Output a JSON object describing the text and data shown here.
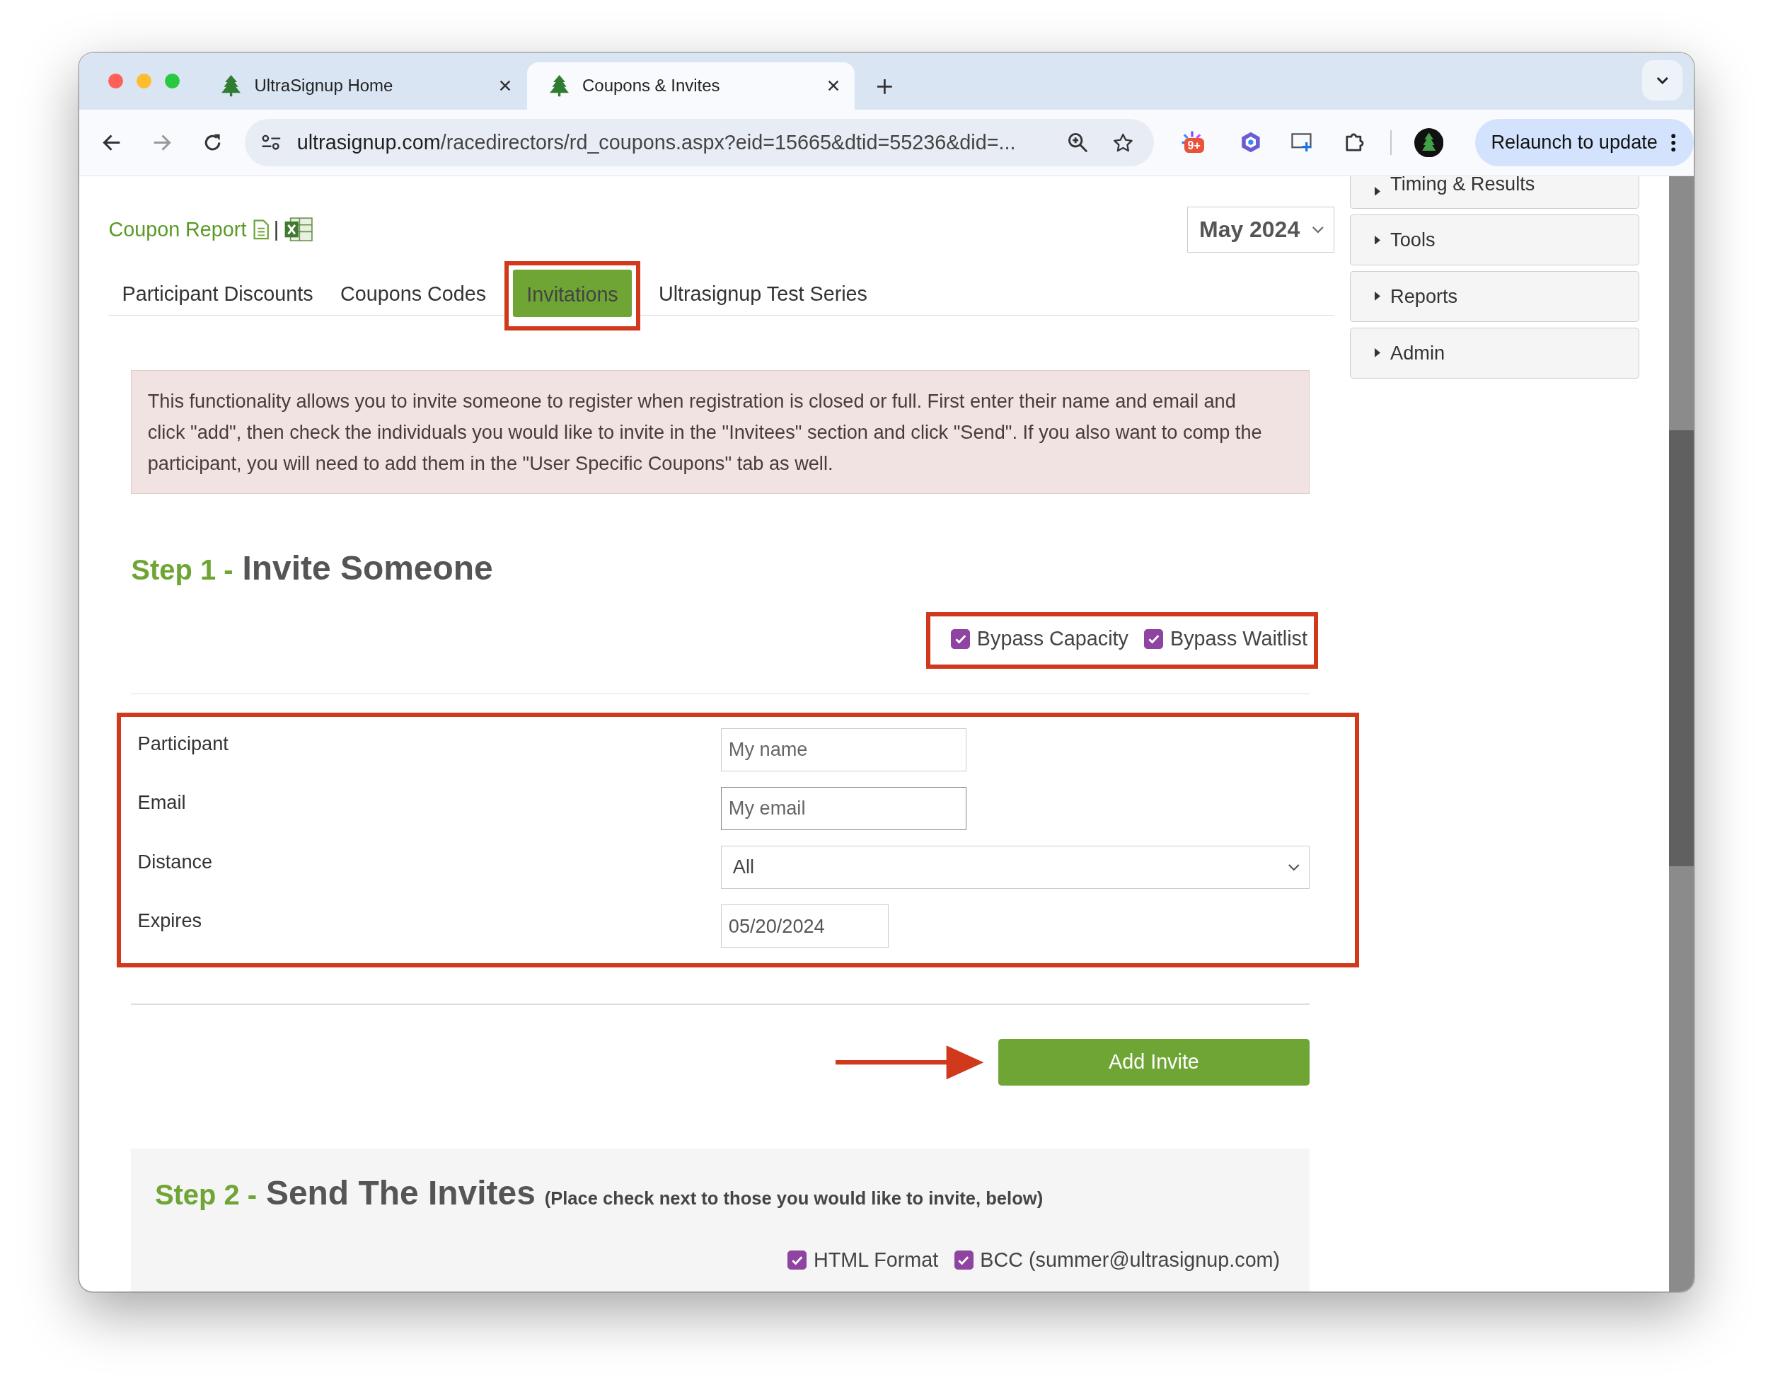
{
  "browser": {
    "tabs": [
      {
        "title": "UltraSignup Home",
        "selected": false
      },
      {
        "title": "Coupons & Invites",
        "selected": true
      }
    ],
    "address": {
      "host": "ultrasignup.com",
      "path": "/racedirectors/rd_coupons.aspx?eid=15665&dtid=55236&did=..."
    },
    "extension_badge": "9+",
    "relaunch_button": "Relaunch to update"
  },
  "page": {
    "report_link": "Coupon Report",
    "separator": "|",
    "month_select": "May 2024",
    "tabs": [
      {
        "label": "Participant Discounts",
        "selected": false
      },
      {
        "label": "Coupons Codes",
        "selected": false
      },
      {
        "label": "Invitations",
        "selected": true
      },
      {
        "label": "Ultrasignup Test Series",
        "selected": false
      }
    ],
    "notice": "This functionality allows you to invite someone to register when registration is closed or full. First enter their name and email and click \"add\", then check the individuals you would like to invite in the \"Invitees\" section and click \"Send\". If you also want to comp the participant, you will need to add them in the \"User Specific Coupons\" tab as well.",
    "step1": {
      "step": "Step 1 -",
      "title": "Invite Someone",
      "options": [
        {
          "label": "Bypass Capacity",
          "checked": true
        },
        {
          "label": "Bypass Waitlist",
          "checked": true
        }
      ]
    },
    "form": {
      "fields": [
        {
          "label": "Participant",
          "kind": "text",
          "placeholder": "My name",
          "focused": false
        },
        {
          "label": "Email",
          "kind": "text",
          "placeholder": "My email",
          "focused": true
        },
        {
          "label": "Distance",
          "kind": "select",
          "value": "All",
          "focused": false
        },
        {
          "label": "Expires",
          "kind": "date",
          "value": "05/20/2024",
          "focused": false
        }
      ]
    },
    "add_button": "Add Invite",
    "step2": {
      "step": "Step 2 -",
      "title": "Send The Invites",
      "hint": "(Place check next to those you would like to invite, below)",
      "options": [
        {
          "label": "HTML Format",
          "checked": true
        },
        {
          "label": "BCC (summer@ultrasignup.com)",
          "checked": true
        }
      ]
    }
  },
  "sidebar": {
    "items": [
      "Timing & Results",
      "Tools",
      "Reports",
      "Admin"
    ]
  }
}
